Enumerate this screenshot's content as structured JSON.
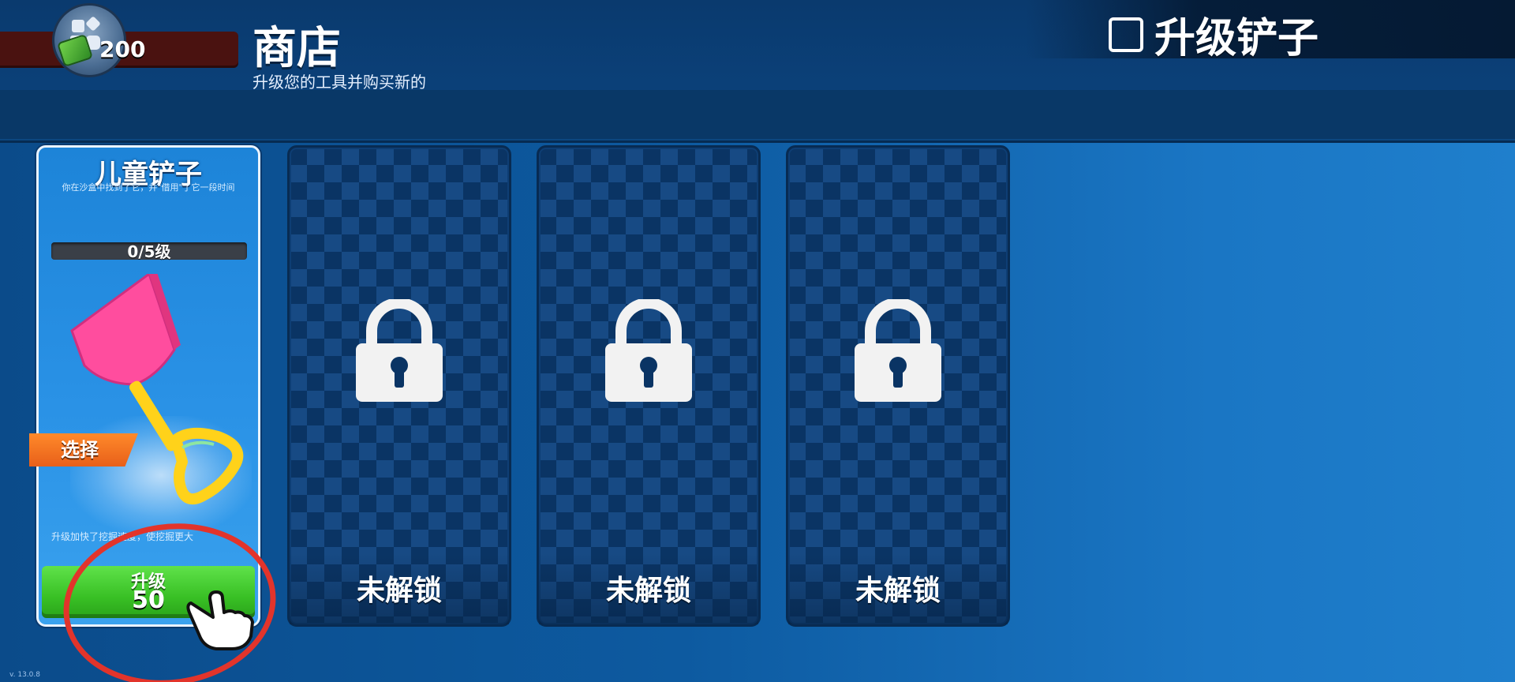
{
  "header": {
    "title": "商店",
    "subtitle": "升级您的工具并购买新的",
    "tutorial_title": "升级铲子"
  },
  "currency": {
    "value": "200",
    "icon": "cash-icon"
  },
  "cards": [
    {
      "name": "儿童铲子",
      "description": "你在沙盒中找到了它，并\"借用\"了它一段时间",
      "level_text": "0/5级",
      "level_progress": 0,
      "select_label": "选择",
      "upgrade_hint": "升级加快了挖掘速度，使挖掘更大",
      "upgrade_label": "升级",
      "upgrade_cost": "50",
      "icon": "shovel-icon"
    },
    {
      "status": "未解锁",
      "icon": "lock-icon"
    },
    {
      "status": "未解锁",
      "icon": "lock-icon"
    },
    {
      "status": "未解锁",
      "icon": "lock-icon"
    }
  ],
  "overlay": {
    "pointer_icon": "hand-pointer-icon",
    "ring_color": "#e2342b"
  },
  "footer": {
    "version": "v. 13.0.8"
  },
  "colors": {
    "upgrade_button": "#39c025",
    "select_tag": "#ff8a2a",
    "locked_card": "#0a3464"
  }
}
